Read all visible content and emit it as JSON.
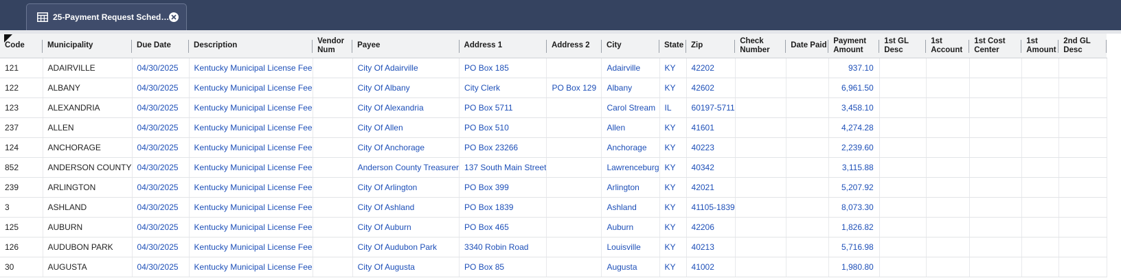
{
  "tab": {
    "title": "25-Payment Request Sched…",
    "icon": "table-grid-icon",
    "close_icon": "close-circle-icon"
  },
  "columns": [
    "Code",
    "Municipality",
    "Due Date",
    "Description",
    "Vendor Num",
    "Payee",
    "Address 1",
    "Address 2",
    "City",
    "State",
    "Zip",
    "Check Number",
    "Date Paid",
    "Payment Amount",
    "1st GL Desc",
    "1st Account",
    "1st Cost Center",
    "1st Amount",
    "2nd GL Desc"
  ],
  "rows": [
    [
      "121",
      "ADAIRVILLE",
      "04/30/2025",
      "Kentucky Municipal License Fee",
      "",
      "City Of Adairville",
      "PO Box 185",
      "",
      "Adairville",
      "KY",
      "42202",
      "",
      "",
      "937.10",
      "",
      "",
      "",
      "",
      ""
    ],
    [
      "122",
      "ALBANY",
      "04/30/2025",
      "Kentucky Municipal License Fee",
      "",
      "City Of Albany",
      "City Clerk",
      "PO Box 129",
      "Albany",
      "KY",
      "42602",
      "",
      "",
      "6,961.50",
      "",
      "",
      "",
      "",
      ""
    ],
    [
      "123",
      "ALEXANDRIA",
      "04/30/2025",
      "Kentucky Municipal License Fee",
      "",
      "City Of Alexandria",
      "PO Box 5711",
      "",
      "Carol Stream",
      "IL",
      "60197-5711",
      "",
      "",
      "3,458.10",
      "",
      "",
      "",
      "",
      ""
    ],
    [
      "237",
      "ALLEN",
      "04/30/2025",
      "Kentucky Municipal License Fee",
      "",
      "City Of Allen",
      "PO Box 510",
      "",
      "Allen",
      "KY",
      "41601",
      "",
      "",
      "4,274.28",
      "",
      "",
      "",
      "",
      ""
    ],
    [
      "124",
      "ANCHORAGE",
      "04/30/2025",
      "Kentucky Municipal License Fee",
      "",
      "City Of Anchorage",
      "PO Box 23266",
      "",
      "Anchorage",
      "KY",
      "40223",
      "",
      "",
      "2,239.60",
      "",
      "",
      "",
      "",
      ""
    ],
    [
      "852",
      "ANDERSON COUNTY",
      "04/30/2025",
      "Kentucky Municipal License Fee",
      "",
      "Anderson County Treasurer",
      "137 South Main Street",
      "",
      "Lawrenceburg",
      "KY",
      "40342",
      "",
      "",
      "3,115.88",
      "",
      "",
      "",
      "",
      ""
    ],
    [
      "239",
      "ARLINGTON",
      "04/30/2025",
      "Kentucky Municipal License Fee",
      "",
      "City Of Arlington",
      "PO Box 399",
      "",
      "Arlington",
      "KY",
      "42021",
      "",
      "",
      "5,207.92",
      "",
      "",
      "",
      "",
      ""
    ],
    [
      "3",
      "ASHLAND",
      "04/30/2025",
      "Kentucky Municipal License Fee",
      "",
      "City Of Ashland",
      "PO Box 1839",
      "",
      "Ashland",
      "KY",
      "41105-1839",
      "",
      "",
      "8,073.30",
      "",
      "",
      "",
      "",
      ""
    ],
    [
      "125",
      "AUBURN",
      "04/30/2025",
      "Kentucky Municipal License Fee",
      "",
      "City Of Auburn",
      "PO Box 465",
      "",
      "Auburn",
      "KY",
      "42206",
      "",
      "",
      "1,826.82",
      "",
      "",
      "",
      "",
      ""
    ],
    [
      "126",
      "AUDUBON PARK",
      "04/30/2025",
      "Kentucky Municipal License Fee",
      "",
      "City Of Audubon Park",
      "3340 Robin Road",
      "",
      "Louisville",
      "KY",
      "40213",
      "",
      "",
      "5,716.98",
      "",
      "",
      "",
      "",
      ""
    ],
    [
      "30",
      "AUGUSTA",
      "04/30/2025",
      "Kentucky Municipal License Fee",
      "",
      "City Of Augusta",
      "PO Box 85",
      "",
      "Augusta",
      "KY",
      "41002",
      "",
      "",
      "1,980.80",
      "",
      "",
      "",
      "",
      ""
    ]
  ],
  "colors": {
    "header_bar": "#354360",
    "link_text": "#1d4fb8"
  }
}
